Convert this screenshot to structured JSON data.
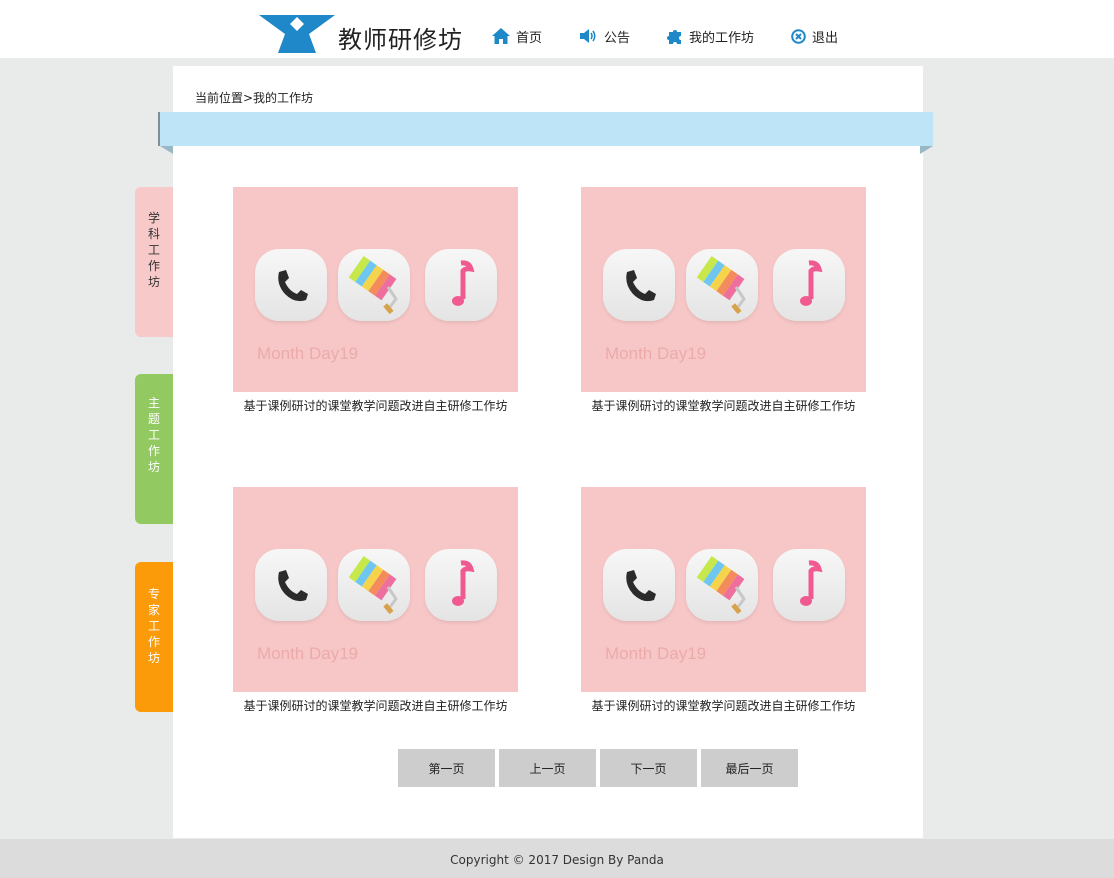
{
  "header": {
    "site_title": "教师研修坊",
    "nav": [
      {
        "label": "首页",
        "icon": "home-icon"
      },
      {
        "label": "公告",
        "icon": "speaker-icon"
      },
      {
        "label": "我的工作坊",
        "icon": "puzzle-icon"
      },
      {
        "label": "退出",
        "icon": "close-circle-icon"
      }
    ]
  },
  "breadcrumb": "当前位置>我的工作坊",
  "side_tabs": [
    {
      "label": "学科工作坊",
      "color": "#f8c9c9"
    },
    {
      "label": "主题工作坊",
      "color": "#93c961"
    },
    {
      "label": "专家工作坊",
      "color": "#fb9b09"
    }
  ],
  "cards": [
    {
      "caption": "基于课例研讨的课堂教学问题改进自主研修工作坊",
      "watermark": "Month Day19",
      "icons": [
        "phone-icon",
        "paint-roller-icon",
        "music-note-icon"
      ]
    },
    {
      "caption": "基于课例研讨的课堂教学问题改进自主研修工作坊",
      "watermark": "Month Day19",
      "icons": [
        "phone-icon",
        "paint-roller-icon",
        "music-note-icon"
      ]
    },
    {
      "caption": "基于课例研讨的课堂教学问题改进自主研修工作坊",
      "watermark": "Month Day19",
      "icons": [
        "phone-icon",
        "paint-roller-icon",
        "music-note-icon"
      ]
    },
    {
      "caption": "基于课例研讨的课堂教学问题改进自主研修工作坊",
      "watermark": "Month Day19",
      "icons": [
        "phone-icon",
        "paint-roller-icon",
        "music-note-icon"
      ]
    }
  ],
  "pagination": {
    "first": "第一页",
    "prev": "上一页",
    "next": "下一页",
    "last": "最后一页"
  },
  "footer": "Copyright © 2017 Design By Panda",
  "colors": {
    "accent_blue": "#1e88c8",
    "card_background": "#f7c7c7",
    "ribbon": "#bde4f7",
    "page_background": "#e9eaea"
  }
}
